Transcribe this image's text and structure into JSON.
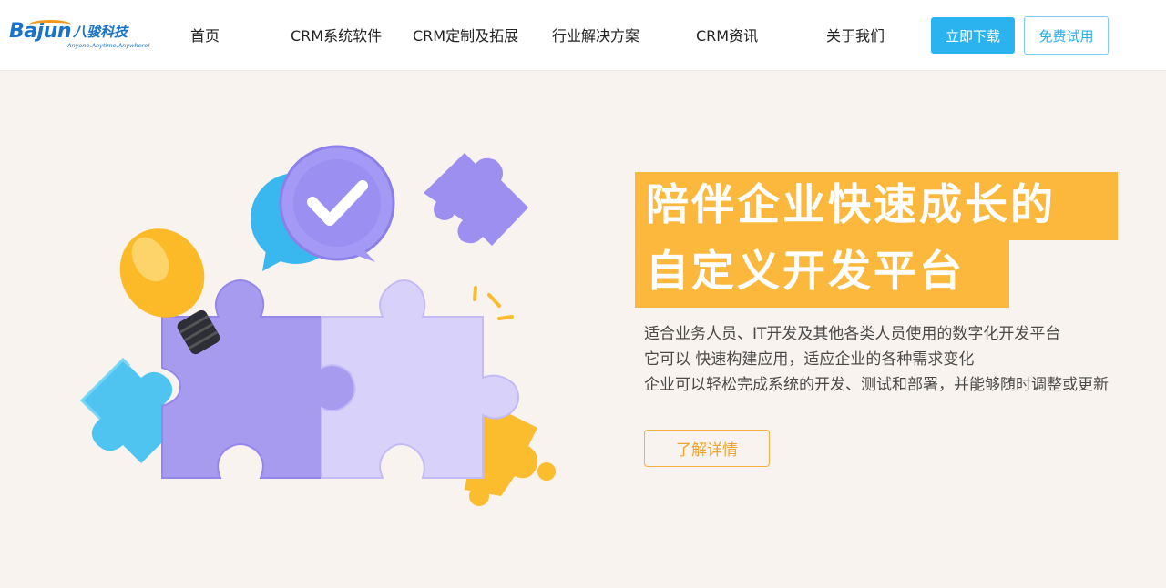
{
  "logo": {
    "brand": "Bajun",
    "cn_name": "八骏科技",
    "tagline": "Anyone,Anytime,Anywhere!"
  },
  "nav": {
    "items": [
      {
        "label": "首页"
      },
      {
        "label": "CRM系统软件"
      },
      {
        "label": "CRM定制及拓展"
      },
      {
        "label": "行业解决方案"
      },
      {
        "label": "CRM资讯"
      },
      {
        "label": "关于我们"
      }
    ],
    "download_label": "立即下载",
    "trial_label": "免费试用"
  },
  "hero": {
    "title_line1": "陪伴企业快速成长的",
    "title_line2": "自定义开发平台",
    "desc_line1": "适合业务人员、IT开发及其他各类人员使用的数字化开发平台",
    "desc_line2": "它可以 快速构建应用，适应企业的各种需求变化",
    "desc_line3": "企业可以轻松完成系统的开发、测试和部署，并能够随时调整或更新",
    "cta_label": "了解详情"
  },
  "colors": {
    "accent_blue": "#2bb3ef",
    "title_orange": "#fbb83c",
    "background": "#f8f3ee",
    "puzzle_purple": "#a89cf0",
    "puzzle_light": "#d6d0fa"
  },
  "icons": [
    "lightbulb-icon",
    "checkmark-bubble-icon",
    "puzzle-icon"
  ]
}
